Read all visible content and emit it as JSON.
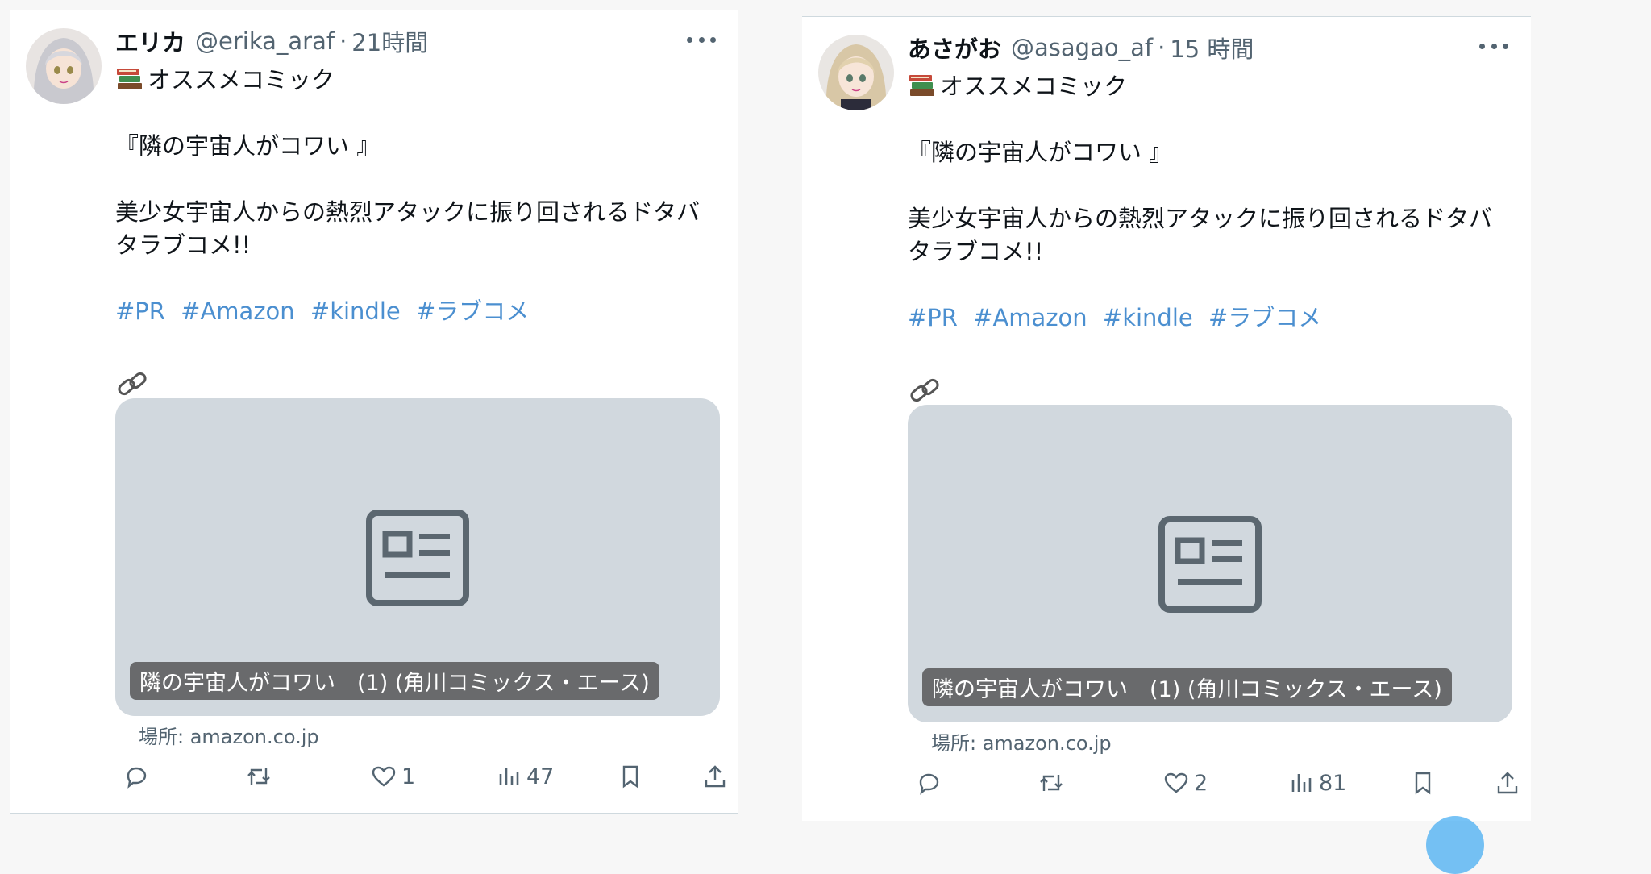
{
  "tweets": [
    {
      "name": "エリカ",
      "handle": "@erika_araf",
      "separator": "·",
      "time": "21時間",
      "category_line": "オススメコミック",
      "title_line": "『隣の宇宙人がコワい 』",
      "desc_line1": "美少女宇宙人からの熱烈アタックに振り回されるドタバ",
      "desc_line2": "タラブコメ!!",
      "hashtags": [
        "#PR",
        "#Amazon",
        "#kindle",
        "#ラブコメ"
      ],
      "card_title": "隣の宇宙人がコワい　(1) (角川コミックス・エース)",
      "source": "場所: amazon.co.jp",
      "actions": {
        "reply_count": "",
        "retweet_count": "",
        "like_count": "1",
        "views_count": "47"
      },
      "icons": [
        "avatar",
        "more-icon",
        "books-emoji-icon",
        "link-icon",
        "article-icon",
        "reply-icon",
        "retweet-icon",
        "like-icon",
        "views-icon",
        "bookmark-icon",
        "share-icon"
      ]
    },
    {
      "name": "あさがお",
      "handle": "@asagao_af",
      "separator": "·",
      "time": "15 時間",
      "category_line": "オススメコミック",
      "title_line": "『隣の宇宙人がコワい 』",
      "desc_line1": "美少女宇宙人からの熱烈アタックに振り回されるドタバ",
      "desc_line2": "タラブコメ!!",
      "hashtags": [
        "#PR",
        "#Amazon",
        "#kindle",
        "#ラブコメ"
      ],
      "card_title": "隣の宇宙人がコワい　(1) (角川コミックス・エース)",
      "source": "場所: amazon.co.jp",
      "actions": {
        "reply_count": "",
        "retweet_count": "",
        "like_count": "2",
        "views_count": "81"
      },
      "icons": [
        "avatar",
        "more-icon",
        "books-emoji-icon",
        "link-icon",
        "article-icon",
        "reply-icon",
        "retweet-icon",
        "like-icon",
        "views-icon",
        "bookmark-icon",
        "share-icon"
      ]
    }
  ],
  "colors": {
    "hashtag": "#4b8fd0",
    "muted": "#536471",
    "card_bg": "#d1d8de",
    "page_bg": "#f7f7f7"
  }
}
